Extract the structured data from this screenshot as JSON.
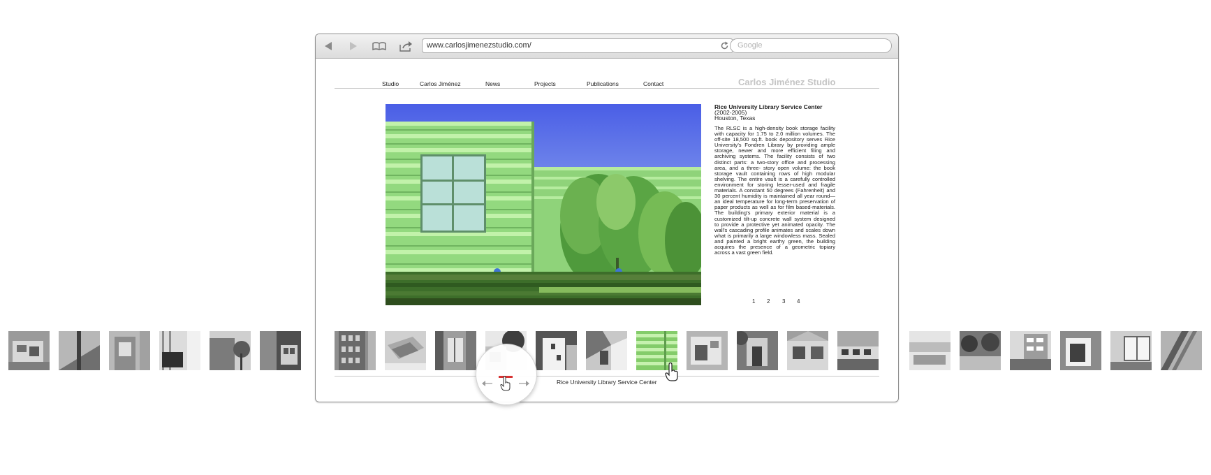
{
  "toolbar": {
    "back_icon": "back-arrow-icon",
    "forward_icon": "forward-arrow-icon",
    "bookmarks_icon": "book-icon",
    "share_icon": "share-icon",
    "url": "www.carlosjimenezstudio.com/",
    "reload_icon": "reload-icon",
    "search_placeholder": "Google"
  },
  "site": {
    "brand": "Carlos Jiménez Studio",
    "nav": [
      "Studio",
      "Carlos Jiménez",
      "News",
      "Projects",
      "Publications",
      "Contact"
    ]
  },
  "project": {
    "title": "Rice University Library Service Center",
    "years": "(2002-2005)",
    "location": "Houston, Texas",
    "description": "The RLSC is a high-density book storage facility with capacity for 1.75 to 2.0 million volumes. The off-site 18,500 sq.ft. book depository serves Rice University's Fondren Library by providing ample storage, newer and more efficient filing and archiving systems. The facility consists of two distinct parts: a two-story office and processing area, and a three- story open volume: the book storage vault containing rows of high modular shelving. The entire vault is a carefully controlled environment for storing lesser-used and fragile materials. A constant 50 degrees (Fahrenheit) and 30 percent humidity is maintained all year round—an ideal temperature for long-term preservation of paper products as well as for film based-materials. The building's primary exterior material is a customized tilt-up concrete wall system designed to provide a protective yet animated opacity. The wall's cascading profile animates and scales down what is primarily a large windowless mass. Sealed and painted a bright earthy green, the building acquires the presence of a geometric topiary across a vast green field.",
    "pages": [
      "1",
      "2",
      "3",
      "4"
    ]
  },
  "filmstrip": {
    "caption": "Rice University Library Service Center",
    "thumbnail_count": 23,
    "selected_index": 13
  },
  "colors": {
    "accent_green": "#9fe08a",
    "sky_blue": "#4f63e6",
    "marker_red": "#d73333"
  }
}
